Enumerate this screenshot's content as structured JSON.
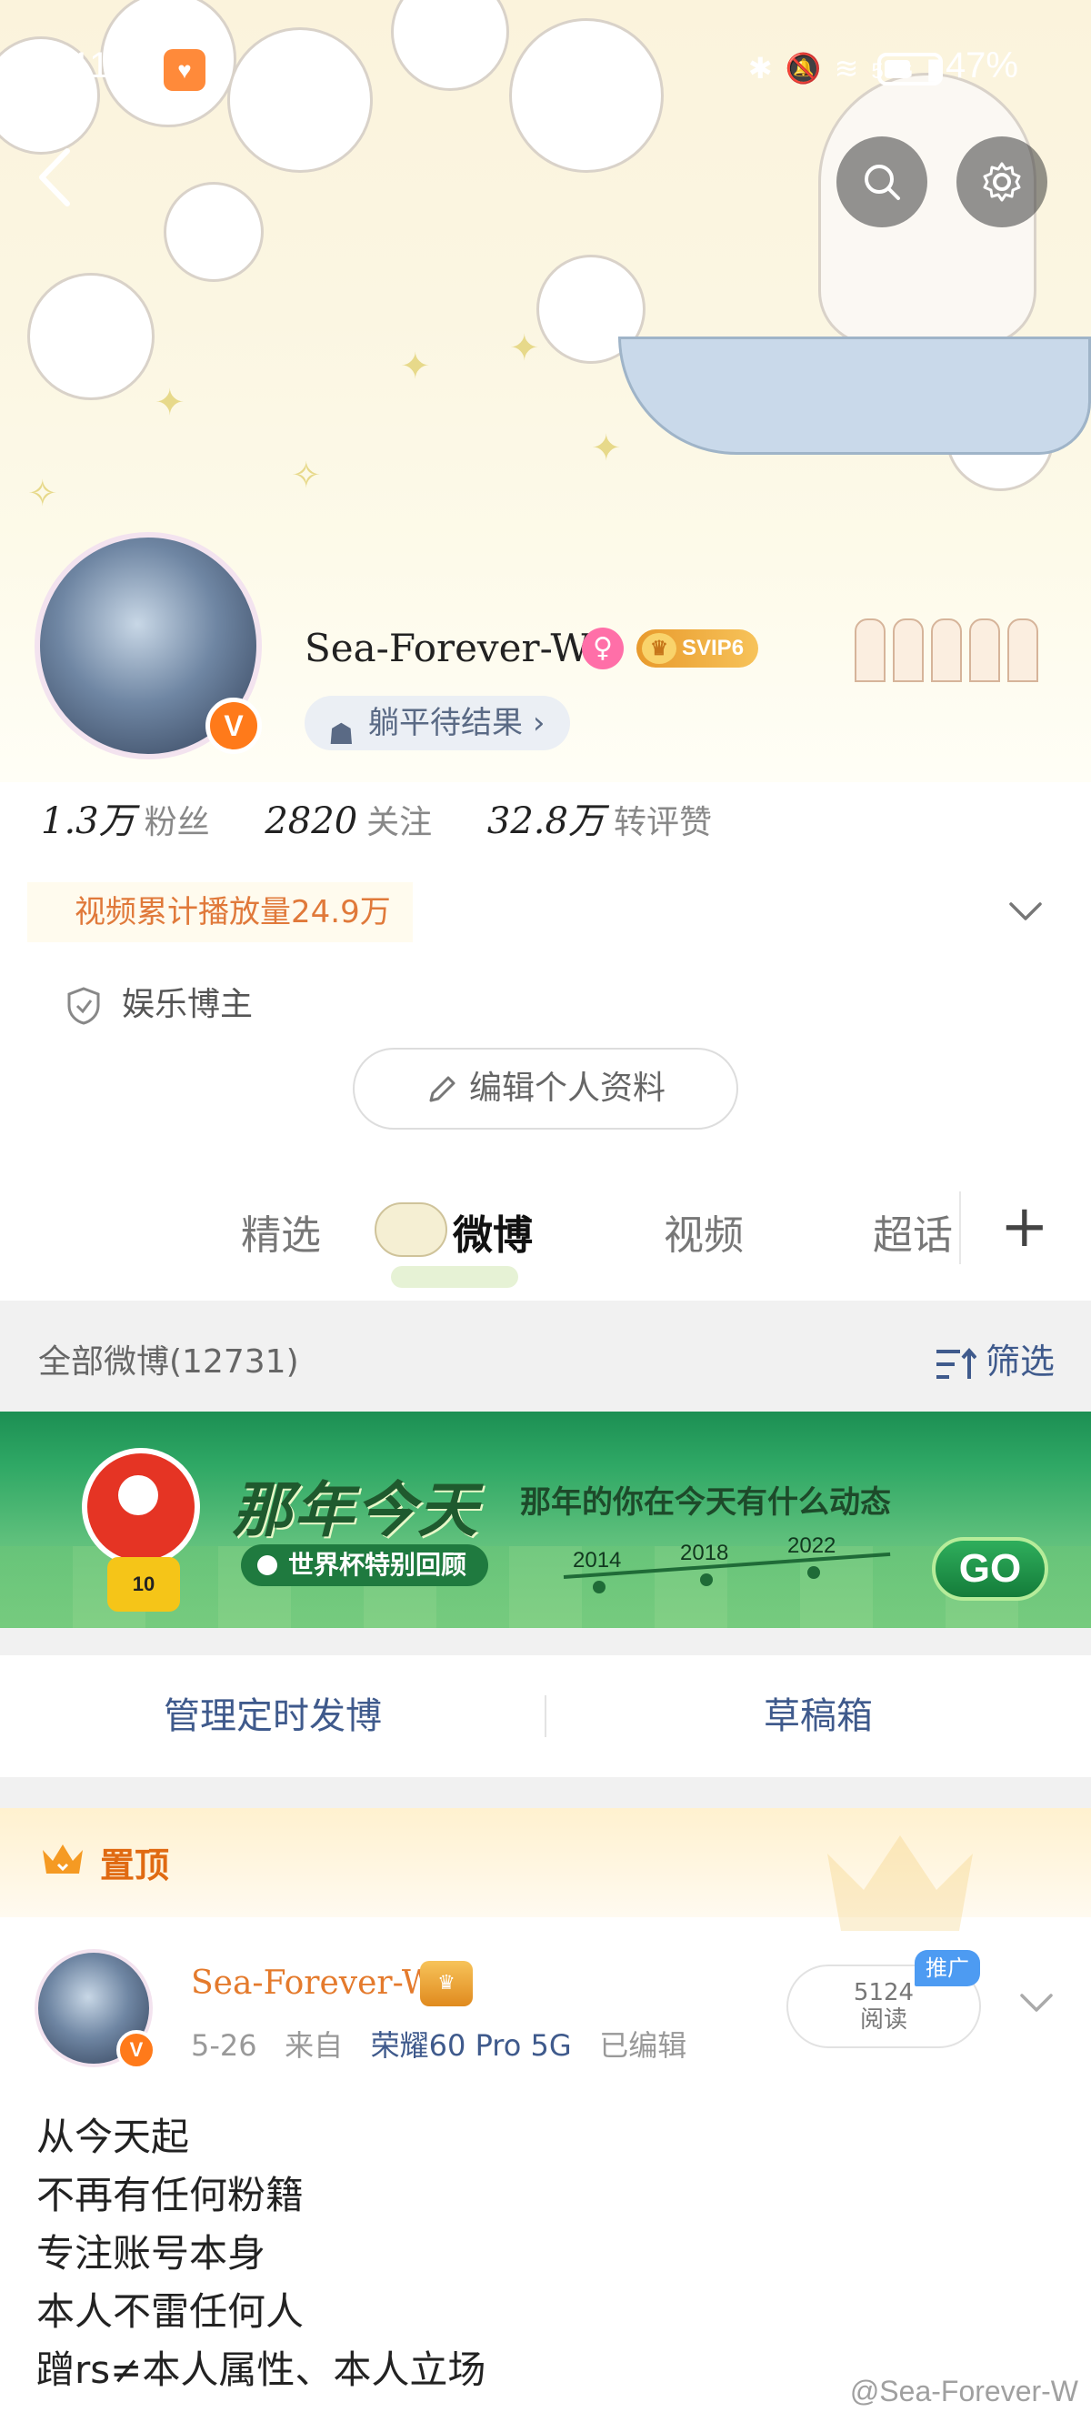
{
  "status_bar": {
    "time": "11:10",
    "network": "5G",
    "battery": "47%"
  },
  "profile": {
    "username": "Sea-Forever-W",
    "verified_badge": "V",
    "svip_label": "SVIP6",
    "status_chip": "躺平待结果",
    "stats": [
      {
        "value": "1.3万",
        "label": "粉丝"
      },
      {
        "value": "2820",
        "label": "关注"
      },
      {
        "value": "32.8万",
        "label": "转评赞"
      }
    ],
    "video_plays": "视频累计播放量24.9万",
    "tag": "娱乐博主",
    "edit_button": "编辑个人资料"
  },
  "tabs": [
    {
      "label": "精选",
      "active": false
    },
    {
      "label": "微博",
      "active": true
    },
    {
      "label": "视频",
      "active": false
    },
    {
      "label": "超话",
      "active": false
    }
  ],
  "filter": {
    "label": "全部微博(12731)",
    "button": "筛选"
  },
  "banner": {
    "title": "那年今天",
    "subtitle": "那年的你在今天有什么动态",
    "pill": "世界杯特别回顾",
    "years": [
      "2014",
      "2018",
      "2022"
    ],
    "go": "GO",
    "mascot_number": "10"
  },
  "actions": {
    "scheduled": "管理定时发博",
    "drafts": "草稿箱"
  },
  "pinned_post": {
    "pinned_label": "置顶",
    "author": "Sea-Forever-W",
    "date": "5-26",
    "from": "来自",
    "device": "荣耀60 Pro 5G",
    "edited": "已编辑",
    "reads_count": "5124",
    "reads_label": "阅读",
    "promo": "推广",
    "lines": [
      "从今天起",
      "不再有任何粉籍",
      "专注账号本身",
      "本人不雷任何人",
      "蹭rs≠本人属性、本人立场"
    ],
    "watermark": "@Sea-Forever-W"
  }
}
